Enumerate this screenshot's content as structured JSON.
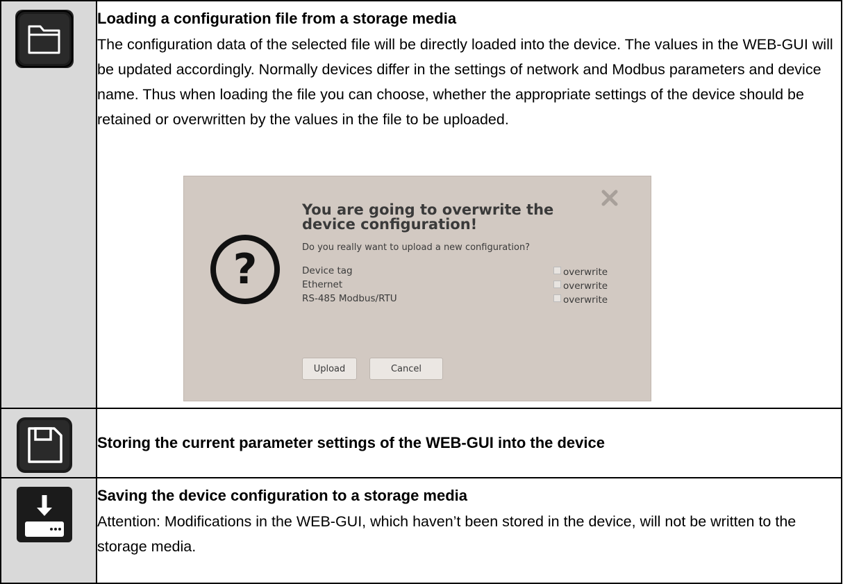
{
  "rows": [
    {
      "icon": "folder-icon",
      "title": "Loading a configuration file from a storage media",
      "body": "The configuration data of the selected file will be directly loaded into the device. The values in the WEB-GUI will be updated accordingly. Normally devices differ in the settings of network and Modbus parameters and device name. Thus when loading the file you can choose, whether the appropriate settings of the device should be retained or overwritten by the values in the file to be uploaded."
    },
    {
      "icon": "save-disk-icon",
      "title": "Storing the current parameter settings of the WEB-GUI into the device"
    },
    {
      "icon": "download-to-drive-icon",
      "title": "Saving the device configuration to a storage media",
      "body": "Attention: Modifications in the WEB-GUI, which haven’t been stored in the device, will not be written to the storage media."
    }
  ],
  "dialog": {
    "title": "You are going to overwrite the device configuration!",
    "question": "Do you really want to upload a new configuration?",
    "options": [
      {
        "label": "Device tag",
        "checkbox_label": "overwrite",
        "checked": false
      },
      {
        "label": "Ethernet",
        "checkbox_label": "overwrite",
        "checked": false
      },
      {
        "label": "RS-485 Modbus/RTU",
        "checkbox_label": "overwrite",
        "checked": false
      }
    ],
    "upload_label": "Upload",
    "cancel_label": "Cancel",
    "question_icon": "question-mark-icon",
    "close_icon": "close-x-icon"
  }
}
